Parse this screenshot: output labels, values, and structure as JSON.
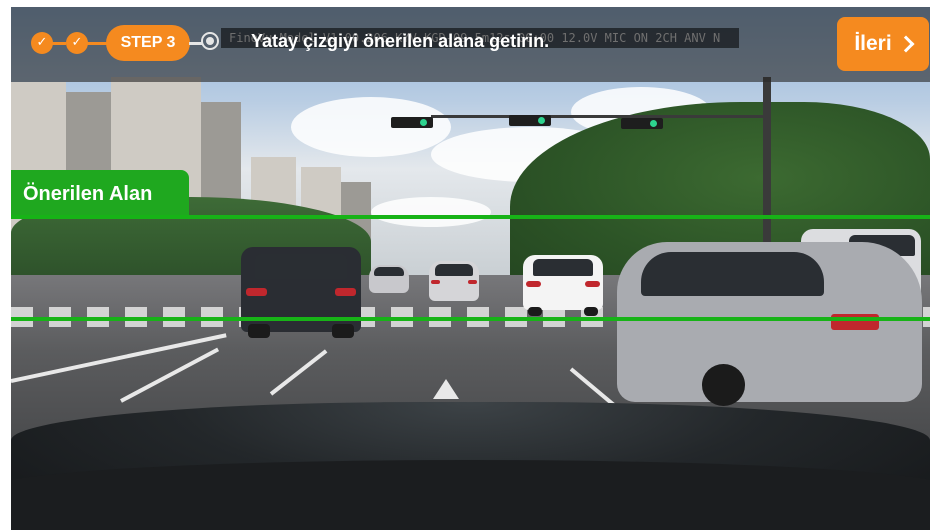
{
  "app": {
    "osd_text": "FineVu Model V1.00.206 KYV.KGD-09  5m12s 00:00  12.0V MIC ON 2CH ANV N"
  },
  "stepper": {
    "completed_steps": [
      {
        "icon": "check-icon"
      },
      {
        "icon": "check-icon"
      }
    ],
    "current_step_label": "STEP 3",
    "next_step_icon": "radio-dot-icon"
  },
  "instruction": {
    "text": "Yatay çizgiyi önerilen alana getirin."
  },
  "next_button": {
    "label": "İleri",
    "icon": "chevron-right-icon"
  },
  "zone": {
    "label": "Önerilen Alan"
  },
  "colors": {
    "accent": "#f58a1f",
    "zone_green": "#17b317",
    "overlay": "rgba(40,40,40,0.62)",
    "text_on_accent": "#ffffff"
  }
}
